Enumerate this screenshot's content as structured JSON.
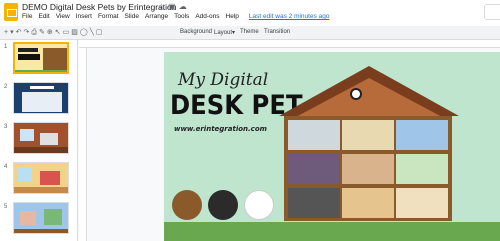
{
  "header": {
    "doc_title": "DEMO Digital Desk Pets by Erintegration",
    "menu": [
      "File",
      "Edit",
      "View",
      "Insert",
      "Format",
      "Slide",
      "Arrange",
      "Tools",
      "Add-ons",
      "Help"
    ],
    "last_edit": "Last edit was 2 minutes ago"
  },
  "toolbar": {
    "background": "Background",
    "layout": "Layout▾",
    "theme": "Theme",
    "transition": "Transition"
  },
  "slides": {
    "numbers": [
      "1",
      "2",
      "3",
      "4",
      "5"
    ]
  },
  "slide": {
    "title_line1": "My Digital",
    "title_line2": "DESK PET",
    "url": "www.erintegration.com"
  },
  "colors": {
    "accent": "#f4b400",
    "slide_bg": "#bfe5cf",
    "link": "#1a73e8"
  }
}
